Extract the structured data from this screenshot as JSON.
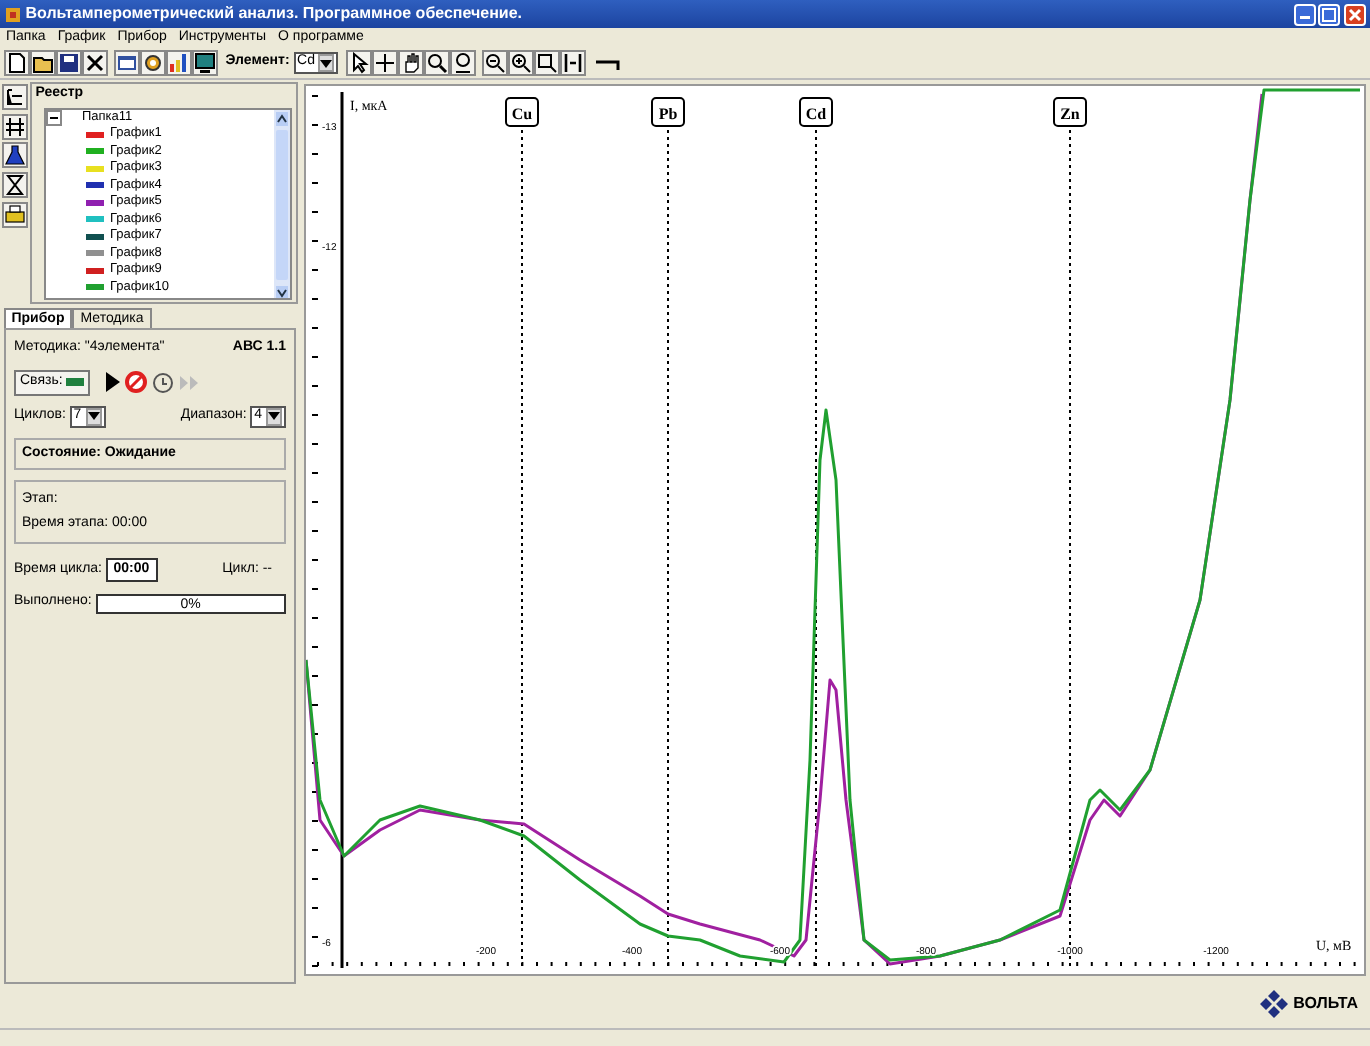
{
  "window": {
    "title": "Вольтамперометрический анализ. Программное обеспечение."
  },
  "menu": [
    "Папка",
    "График",
    "Прибор",
    "Инструменты",
    "О программе"
  ],
  "toolbar": {
    "element_label": "Элемент:",
    "element_value": "Cd"
  },
  "registry": {
    "title": "Реестр",
    "tree": {
      "label": "Папка11",
      "expanded": true,
      "children": [
        {
          "label": "График1",
          "color": "#e02020"
        },
        {
          "label": "График2",
          "color": "#20b020"
        },
        {
          "label": "График3",
          "color": "#e8e020"
        },
        {
          "label": "График4",
          "color": "#2030b0"
        },
        {
          "label": "График5",
          "color": "#9020b0"
        },
        {
          "label": "График6",
          "color": "#20c0c0"
        },
        {
          "label": "График7",
          "color": "#105050"
        },
        {
          "label": "График8",
          "color": "#909090"
        },
        {
          "label": "График9",
          "color": "#d02020"
        },
        {
          "label": "График10",
          "color": "#20a030"
        }
      ]
    }
  },
  "tabs": [
    {
      "label": "Прибор",
      "selected": true
    },
    {
      "label": "Методика",
      "selected": false
    }
  ],
  "panel": {
    "method": "Методика: \"4элемента\"",
    "version": "АВС 1.1",
    "link_label": "Связь:",
    "cycles_label": "Циклов:",
    "cycles_value": "7",
    "range_label": "Диапазон:",
    "range_value": "4",
    "state": "Состояние: Ожидание",
    "stage": "Этап:",
    "stage_time": "Время этапа: 00:00",
    "cycle_time_label": "Время цикла:",
    "cycle_time": "00:00",
    "cycle": "Цикл: --",
    "done_label": "Выполнено:",
    "progress": {
      "level": 0,
      "reading": "0%"
    }
  },
  "chart": {
    "ylabel": "I, мкА",
    "xlabel": "U, мВ",
    "yticks": [
      "-13",
      "-12",
      "-6"
    ],
    "xticks": [
      "-200",
      "-400",
      "-600",
      "-800",
      "-1000",
      "-1200"
    ],
    "markers": [
      "Cu",
      "Pb",
      "Cd",
      "Zn"
    ]
  },
  "logo": "ВОЛЬТА"
}
